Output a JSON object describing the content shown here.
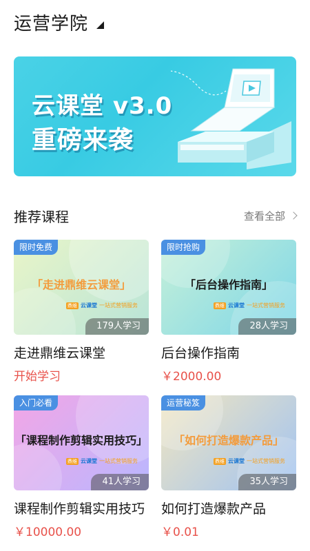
{
  "header": {
    "title": "运营学院"
  },
  "banner": {
    "line1": "云课堂 v3.0",
    "line2": "重磅来袭",
    "dots": 3,
    "active_dot": 0
  },
  "section": {
    "title": "推荐课程",
    "see_all": "查看全部"
  },
  "courses": [
    {
      "tag": "限时免费",
      "thumb_title": "「走进鼎维云课堂」",
      "learners": "179人学习",
      "title": "走进鼎维云课堂",
      "price": "开始学习",
      "colors": {
        "bg_from": "#e9f5c8",
        "bg_to": "#b8e4d8",
        "tag": "#4a90e2",
        "thumb_text": "#f39c3d"
      }
    },
    {
      "tag": "限时抢购",
      "thumb_title": "「后台操作指南」",
      "learners": "28人学习",
      "title": "后台操作指南",
      "price": "￥2000.00",
      "colors": {
        "bg_from": "#c6f0d8",
        "bg_to": "#7dd6e8",
        "tag": "#4a90e2",
        "thumb_text": "#1a1a1a"
      }
    },
    {
      "tag": "入门必看",
      "thumb_title": "「课程制作剪辑实用技巧」",
      "learners": "41人学习",
      "title": "课程制作剪辑实用技巧",
      "price": "￥10000.00",
      "colors": {
        "bg_from": "#f3a6e6",
        "bg_to": "#b9b7ff",
        "tag": "#4a90e2",
        "thumb_text": "#1a1a1a"
      }
    },
    {
      "tag": "运营秘笈",
      "thumb_title": "「如何打造爆款产品」",
      "learners": "35人学习",
      "title": "如何打造爆款产品",
      "price": "￥0.01",
      "colors": {
        "bg_from": "#f2e6c0",
        "bg_to": "#9fc2f2",
        "tag": "#4a90e2",
        "thumb_text": "#f39c3d"
      }
    }
  ],
  "mini_logo": {
    "badge": "鼎维",
    "name": "云课堂",
    "slogan": "一站式营销服务"
  }
}
